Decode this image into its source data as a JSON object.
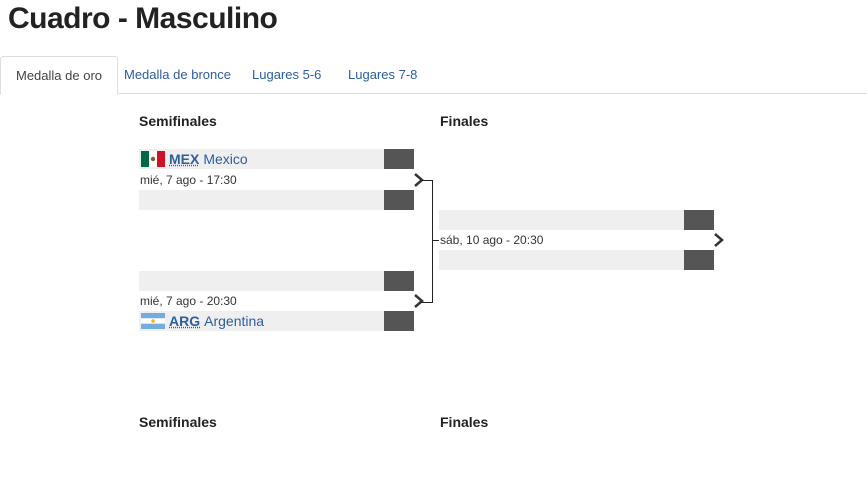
{
  "page": {
    "title": "Cuadro - Masculino"
  },
  "tabs": [
    {
      "label": "Medalla de oro",
      "active": true
    },
    {
      "label": "Medalla de bronce",
      "active": false
    },
    {
      "label": "Lugares 5-6",
      "active": false
    },
    {
      "label": "Lugares 7-8",
      "active": false
    }
  ],
  "sections": [
    {
      "rounds": [
        "Semifinales",
        "Finales"
      ],
      "semifinals": [
        {
          "date": "mié, 7 ago - 17:30",
          "team1": {
            "abbr": "MEX",
            "name": "Mexico",
            "flag": "mexico-flag-icon"
          },
          "team2": null
        },
        {
          "date": "mié, 7 ago - 20:30",
          "team1": null,
          "team2": {
            "abbr": "ARG",
            "name": "Argentina",
            "flag": "argentina-flag-icon"
          }
        }
      ],
      "final": {
        "date": "sáb, 10 ago - 20:30"
      }
    },
    {
      "rounds": [
        "Semifinales",
        "Finales"
      ]
    }
  ],
  "colors": {
    "link": "#2d5e9e",
    "score_box": "#555555",
    "row_bg": "#efefef"
  }
}
